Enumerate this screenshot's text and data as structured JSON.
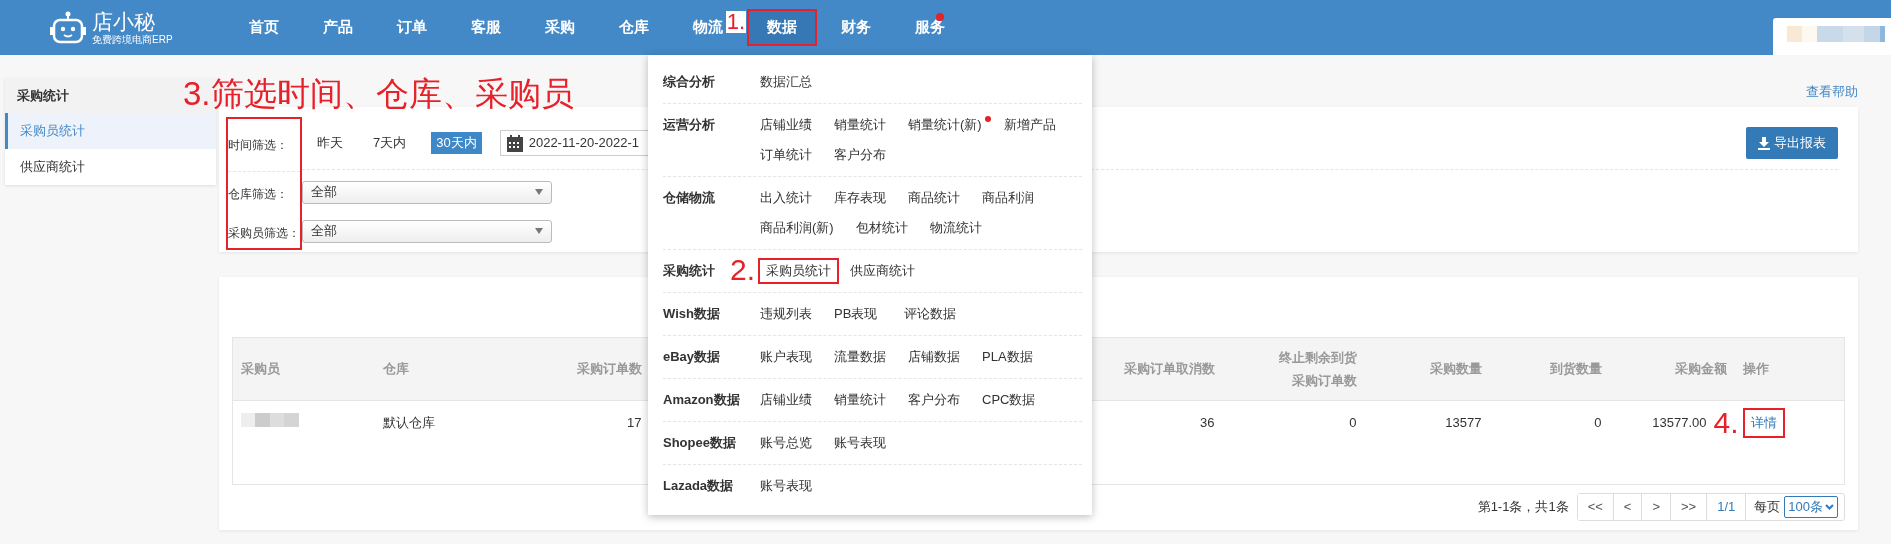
{
  "app": {
    "logo_text": "店小秘",
    "logo_subtitle": "免费跨境电商ERP"
  },
  "nav": [
    {
      "label": "首页",
      "selected": false,
      "highlighted": false,
      "dot": false
    },
    {
      "label": "产品",
      "selected": false,
      "highlighted": false,
      "dot": false
    },
    {
      "label": "订单",
      "selected": false,
      "highlighted": false,
      "dot": false
    },
    {
      "label": "客服",
      "selected": false,
      "highlighted": false,
      "dot": false
    },
    {
      "label": "采购",
      "selected": false,
      "highlighted": false,
      "dot": false
    },
    {
      "label": "仓库",
      "selected": false,
      "highlighted": false,
      "dot": false
    },
    {
      "label": "物流",
      "selected": false,
      "highlighted": false,
      "dot": false
    },
    {
      "label": "数据",
      "selected": true,
      "highlighted": true,
      "dot": false,
      "annotation": "1."
    },
    {
      "label": "财务",
      "selected": false,
      "highlighted": false,
      "dot": false
    },
    {
      "label": "服务",
      "selected": false,
      "highlighted": false,
      "dot": true
    }
  ],
  "sidebar": {
    "title": "采购统计",
    "items": [
      {
        "label": "采购员统计",
        "selected": true
      },
      {
        "label": "供应商统计",
        "selected": false
      }
    ]
  },
  "help_link": "查看帮助",
  "filters": {
    "labels_highlighted": true,
    "annotation": "3.筛选时间、仓库、采购员",
    "time": {
      "label": "时间筛选：",
      "options": [
        {
          "label": "昨天",
          "selected": false
        },
        {
          "label": "7天内",
          "selected": false
        },
        {
          "label": "30天内",
          "selected": true
        }
      ],
      "date_range": "2022-11-20-2022-1"
    },
    "warehouse": {
      "label": "仓库筛选：",
      "value": "全部"
    },
    "buyer": {
      "label": "采购员筛选：",
      "value": "全部"
    }
  },
  "export_button": "导出报表",
  "table": {
    "columns": [
      {
        "lines": [
          "采购员"
        ]
      },
      {
        "lines": [
          "仓库"
        ]
      },
      {
        "lines": [
          "采购订单数"
        ]
      },
      {
        "lines": [
          "采购订单取消数"
        ]
      },
      {
        "lines": [
          "终止剩余到货",
          "采购订单数"
        ]
      },
      {
        "lines": [
          "采购数量"
        ]
      },
      {
        "lines": [
          "到货数量"
        ]
      },
      {
        "lines": [
          "采购金额"
        ]
      },
      {
        "lines": [
          "操作"
        ]
      }
    ],
    "rows": [
      {
        "cells": [
          {
            "kind": "blurred"
          },
          {
            "kind": "text",
            "text": "默认仓库"
          },
          {
            "kind": "text",
            "text": "17"
          },
          {
            "kind": "text",
            "text": "36"
          },
          {
            "kind": "text",
            "text": "0"
          },
          {
            "kind": "text",
            "text": "13577"
          },
          {
            "kind": "text",
            "text": "0"
          },
          {
            "kind": "text",
            "text": "13577.00"
          },
          {
            "kind": "link",
            "text": "详情",
            "highlighted": true,
            "annotation": "4."
          }
        ]
      }
    ]
  },
  "pagination": {
    "summary": "第1-1条，共1条",
    "buttons": [
      "<<",
      "<",
      ">",
      ">>"
    ],
    "page": "1/1",
    "per_page_label": "每页",
    "per_page": "100条"
  },
  "dropdown": {
    "groups": [
      {
        "title": "综合分析",
        "items": [
          {
            "label": "数据汇总",
            "dot": false,
            "highlighted": false
          }
        ]
      },
      {
        "title": "运营分析",
        "items": [
          {
            "label": "店铺业绩",
            "dot": false,
            "highlighted": false
          },
          {
            "label": "销量统计",
            "dot": false,
            "highlighted": false
          },
          {
            "label": "销量统计(新)",
            "dot": true,
            "highlighted": false
          },
          {
            "label": "新增产品",
            "dot": false,
            "highlighted": false
          },
          {
            "label": "订单统计",
            "dot": false,
            "highlighted": false
          },
          {
            "label": "客户分布",
            "dot": false,
            "highlighted": false
          }
        ]
      },
      {
        "title": "仓储物流",
        "items": [
          {
            "label": "出入统计",
            "dot": false,
            "highlighted": false
          },
          {
            "label": "库存表现",
            "dot": false,
            "highlighted": false
          },
          {
            "label": "商品统计",
            "dot": false,
            "highlighted": false
          },
          {
            "label": "商品利润",
            "dot": false,
            "highlighted": false
          },
          {
            "label": "商品利润(新)",
            "dot": false,
            "highlighted": false
          },
          {
            "label": "包材统计",
            "dot": false,
            "highlighted": false
          },
          {
            "label": "物流统计",
            "dot": false,
            "highlighted": false
          }
        ]
      },
      {
        "title": "采购统计",
        "items": [
          {
            "label": "采购员统计",
            "dot": false,
            "highlighted": true,
            "annotation": "2."
          },
          {
            "label": "供应商统计",
            "dot": false,
            "highlighted": false
          }
        ]
      },
      {
        "title": "Wish数据",
        "items": [
          {
            "label": "违规列表",
            "dot": false,
            "highlighted": false
          },
          {
            "label": "PB表现",
            "dot": false,
            "highlighted": false
          },
          {
            "label": "评论数据",
            "dot": false,
            "highlighted": false
          }
        ]
      },
      {
        "title": "eBay数据",
        "items": [
          {
            "label": "账户表现",
            "dot": false,
            "highlighted": false
          },
          {
            "label": "流量数据",
            "dot": false,
            "highlighted": false
          },
          {
            "label": "店铺数据",
            "dot": false,
            "highlighted": false
          },
          {
            "label": "PLA数据",
            "dot": false,
            "highlighted": false
          }
        ]
      },
      {
        "title": "Amazon数据",
        "items": [
          {
            "label": "店铺业绩",
            "dot": false,
            "highlighted": false
          },
          {
            "label": "销量统计",
            "dot": false,
            "highlighted": false
          },
          {
            "label": "客户分布",
            "dot": false,
            "highlighted": false
          },
          {
            "label": "CPC数据",
            "dot": false,
            "highlighted": false
          }
        ]
      },
      {
        "title": "Shopee数据",
        "items": [
          {
            "label": "账号总览",
            "dot": false,
            "highlighted": false
          },
          {
            "label": "账号表现",
            "dot": false,
            "highlighted": false
          }
        ]
      },
      {
        "title": "Lazada数据",
        "items": [
          {
            "label": "账号表现",
            "dot": false,
            "highlighted": false
          }
        ]
      }
    ]
  }
}
